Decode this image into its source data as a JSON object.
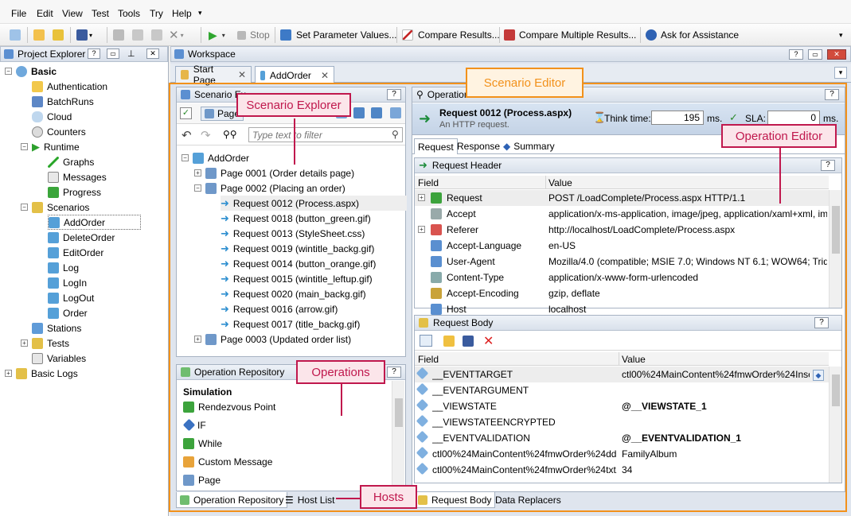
{
  "menu": [
    "File",
    "Edit",
    "View",
    "Test",
    "Tools",
    "Try",
    "Help"
  ],
  "toolbar": {
    "stop": "Stop",
    "set_params": "Set Parameter Values...",
    "compare_results": "Compare Results...",
    "compare_multiple": "Compare Multiple Results...",
    "ask_assistance": "Ask for Assistance"
  },
  "project_explorer": {
    "title": "Project Explorer",
    "items": [
      "Basic",
      "Authentication",
      "BatchRuns",
      "Cloud",
      "Counters",
      "Runtime",
      "Graphs",
      "Messages",
      "Progress",
      "Scenarios",
      "AddOrder",
      "DeleteOrder",
      "EditOrder",
      "Log",
      "LogIn",
      "LogOut",
      "Order",
      "Stations",
      "Tests",
      "Variables",
      "Basic Logs"
    ]
  },
  "workspace": {
    "title": "Workspace",
    "tabs": [
      "Start Page",
      "AddOrder"
    ]
  },
  "scenario_explorer": {
    "title": "Scenario Ex",
    "pages_btn": "Page",
    "filter_placeholder": "Type text to filter",
    "tree": [
      "AddOrder",
      "Page 0001 (Order details page)",
      "Page 0002 (Placing an order)",
      "Request 0012 (Process.aspx)",
      "Request 0018 (button_green.gif)",
      "Request 0013 (StyleSheet.css)",
      "Request 0019 (wintitle_backg.gif)",
      "Request 0014 (button_orange.gif)",
      "Request 0015 (wintitle_leftup.gif)",
      "Request 0020 (main_backg.gif)",
      "Request 0016 (arrow.gif)",
      "Request 0017 (title_backg.gif)",
      "Page 0003 (Updated order list)"
    ]
  },
  "operation_repository": {
    "title": "Operation Repository",
    "group": "Simulation",
    "items": [
      "Rendezvous Point",
      "IF",
      "While",
      "Custom Message",
      "Page"
    ],
    "bottom_tabs": [
      "Operation Repository",
      "Host List"
    ]
  },
  "operation_editor": {
    "title": "Operation",
    "request_title": "Request 0012 (Process.aspx)",
    "request_subtitle": "An HTTP request.",
    "think_time_label": "Think time:",
    "think_time_value": "195",
    "ms1": "ms.",
    "sla_label": "SLA:",
    "sla_value": "0",
    "ms2": "ms.",
    "tabs": [
      "Request",
      "Response",
      "Summary"
    ],
    "request_header_title": "Request Header",
    "col_field": "Field",
    "col_value": "Value",
    "header_rows": [
      {
        "field": "Request",
        "value": "POST /LoadComplete/Process.aspx HTTP/1.1"
      },
      {
        "field": "Accept",
        "value": "application/x-ms-application, image/jpeg, application/xaml+xml, image..."
      },
      {
        "field": "Referer",
        "value": "http://localhost/LoadComplete/Process.aspx"
      },
      {
        "field": "Accept-Language",
        "value": "en-US"
      },
      {
        "field": "User-Agent",
        "value": "Mozilla/4.0 (compatible; MSIE 7.0; Windows NT 6.1; WOW64; Trident/..."
      },
      {
        "field": "Content-Type",
        "value": "application/x-www-form-urlencoded"
      },
      {
        "field": "Accept-Encoding",
        "value": "gzip, deflate"
      },
      {
        "field": "Host",
        "value": "localhost"
      }
    ],
    "request_body_title": "Request Body",
    "body_rows": [
      {
        "field": "__EVENTTARGET",
        "value": "ctl00%24MainContent%24fmwOrder%24Inse..."
      },
      {
        "field": "__EVENTARGUMENT",
        "value": ""
      },
      {
        "field": "__VIEWSTATE",
        "value": "@__VIEWSTATE_1"
      },
      {
        "field": "__VIEWSTATEENCRYPTED",
        "value": ""
      },
      {
        "field": "__EVENTVALIDATION",
        "value": "@__EVENTVALIDATION_1"
      },
      {
        "field": "ctl00%24MainContent%24fmwOrder%24ddlP...",
        "value": "FamilyAlbum"
      },
      {
        "field": "ctl00%24MainContent%24fmwOrder%24txt...",
        "value": "34"
      }
    ],
    "bottom_tabs": [
      "Request Body",
      "Data Replacers"
    ]
  },
  "callouts": {
    "scenario_editor": "Scenario Editor",
    "scenario_explorer": "Scenario Explorer",
    "operation_editor": "Operation Editor",
    "operations": "Operations",
    "hosts": "Hosts"
  },
  "colors": {
    "accent_orange": "#f2911b",
    "callout_red": "#c0184d",
    "callout_fill": "#fbe5ea"
  }
}
